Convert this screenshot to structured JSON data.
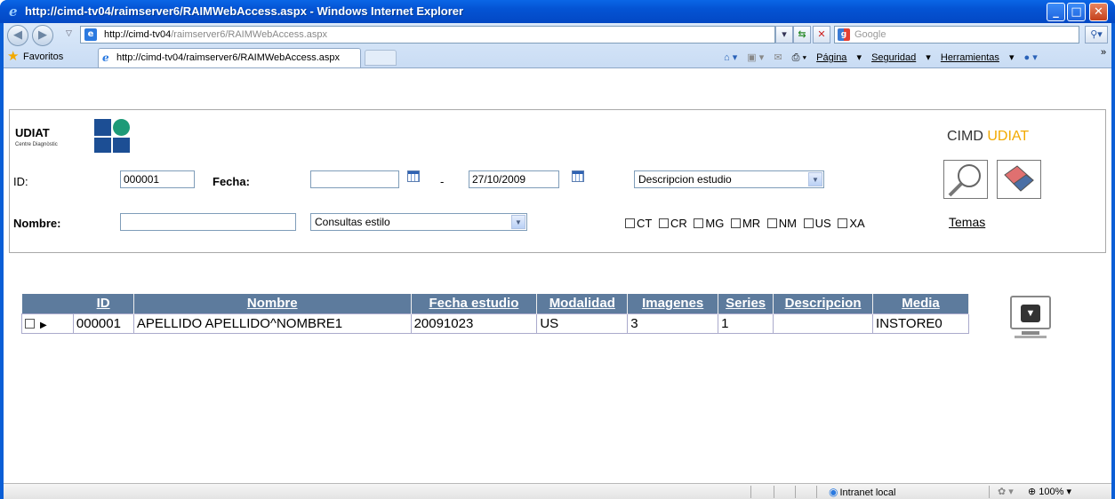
{
  "window": {
    "title": "http://cimd-tv04/raimserver6/RAIMWebAccess.aspx - Windows Internet Explorer",
    "min": "_",
    "max": "□",
    "close": "✕"
  },
  "browser": {
    "address_host": "http://cimd-tv04",
    "address_path": "/raimserver6/RAIMWebAccess.aspx",
    "search_placeholder": "Google",
    "favorites_label": "Favoritos",
    "tab_title": "http://cimd-tv04/raimserver6/RAIMWebAccess.aspx",
    "cmd_pagina": "Página",
    "cmd_seguridad": "Seguridad",
    "cmd_herramientas": "Herramientas",
    "more": "»",
    "status_zone": "Intranet local",
    "zoom": "100%"
  },
  "logo": {
    "name": "UDIAT",
    "sub": "Centre Diagnòstic",
    "brand_prefix": "CIMD",
    "brand_suffix": "UDIAT",
    "brand_color": "#f2a900"
  },
  "form": {
    "id_label": "ID:",
    "id_value": "000001",
    "fecha_label": "Fecha:",
    "fecha_from": "",
    "dash": "-",
    "fecha_to": "27/10/2009",
    "descripcion_select": "Descripcion estudio",
    "nombre_label": "Nombre:",
    "nombre_value": "",
    "consultas_select": "Consultas estilo",
    "modalities": [
      "CT",
      "CR",
      "MG",
      "MR",
      "NM",
      "US",
      "XA"
    ],
    "temas": "Temas"
  },
  "grid": {
    "header_color": "#5d7b9d",
    "columns": [
      "ID",
      "Nombre",
      "Fecha estudio",
      "Modalidad",
      "Imagenes",
      "Series",
      "Descripcion",
      "Media"
    ],
    "rows": [
      [
        "000001",
        "APELLIDO APELLIDO^NOMBRE1",
        "20091023",
        "US",
        "3",
        "1",
        "",
        "INSTORE0"
      ]
    ]
  }
}
